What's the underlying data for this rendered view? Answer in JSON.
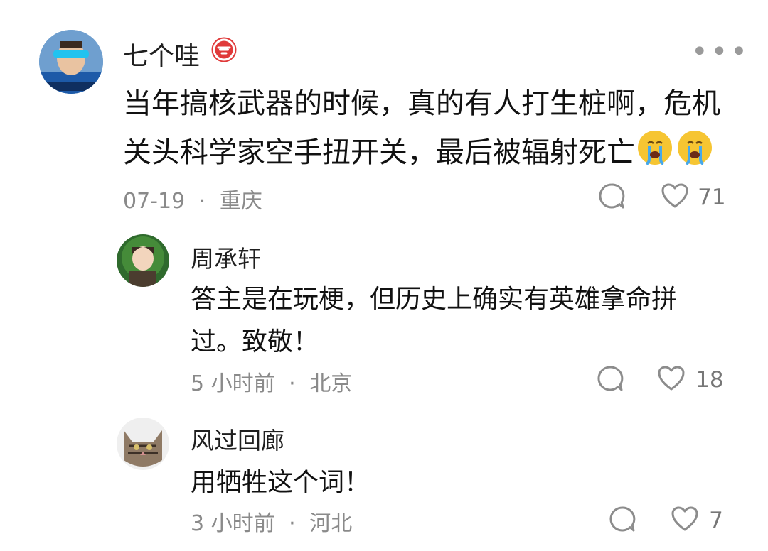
{
  "comment": {
    "author": "七个哇",
    "text_line1": "当年搞核武器的时候，真的有人打生桩啊，危机",
    "text_line2": "关头科学家空手扭开关，最后被辐射死亡",
    "date": "07-19",
    "location": "重庆",
    "likes": "71"
  },
  "replies": [
    {
      "author": "周承轩",
      "text_line1": "答主是在玩梗，但历史上确实有英雄拿命拼",
      "text_line2": "过。致敬！",
      "time": "5 小时前",
      "location": "北京",
      "likes": "18"
    },
    {
      "author": "风过回廊",
      "text_line1": "用牺牲这个词！",
      "time": "3 小时前",
      "location": "河北",
      "likes": "7"
    }
  ],
  "icons": {
    "badge": "coffee-badge-icon",
    "more": "more-icon",
    "comment": "comment-icon",
    "like": "heart-icon",
    "emoji": "crying-emoji"
  },
  "more_glyph": "•••",
  "separator": "·",
  "colors": {
    "badge_red": "#e03a3a",
    "meta_gray": "#8a8a8a",
    "icon_gray": "#8c8c8c"
  }
}
